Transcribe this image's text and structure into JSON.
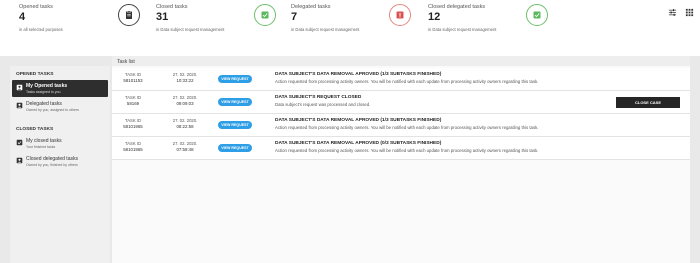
{
  "stats": [
    {
      "label": "Opened tasks",
      "value": "4",
      "sub": "in all selected purposes",
      "icon": "clipboard-icon",
      "tone": "dark"
    },
    {
      "label": "Closed tasks",
      "value": "31",
      "sub": "in Data subject request management",
      "icon": "check-box-icon",
      "tone": "green"
    },
    {
      "label": "Delegated tasks",
      "value": "7",
      "sub": "in Data subject request management",
      "icon": "alert-box-icon",
      "tone": "red"
    },
    {
      "label": "Closed delegated tasks",
      "value": "12",
      "sub": "in Data subject request management",
      "icon": "check-box-icon",
      "tone": "green"
    }
  ],
  "colors": {
    "accent": "#2e9ee6",
    "dark": "#2e2e2e",
    "green": "#5cb85c",
    "red": "#d9534f"
  },
  "sidebar": {
    "opened_title": "OPENED TASKS",
    "closed_title": "CLOSED TASKS",
    "items": [
      {
        "title": "My Opened tasks",
        "desc": "Tasks assigned to you",
        "icon": "user-tasks-icon"
      },
      {
        "title": "Delegated tasks",
        "desc": "Owned by you, assigned to others",
        "icon": "delegated-tasks-icon"
      },
      {
        "title": "My closed tasks",
        "desc": "Your finished tasks",
        "icon": "closed-tasks-icon"
      },
      {
        "title": "Closed delegated tasks",
        "desc": "Owned by you, finished by others",
        "icon": "closed-delegated-icon"
      }
    ]
  },
  "panel": {
    "title": "Task list"
  },
  "tasks": [
    {
      "id_label": "TASK ID",
      "id": "58101153",
      "date": "27. 02. 2020.",
      "time": "10:33:22",
      "button": "VIEW REQUEST",
      "title": "DATA SUBJECT'S DATA REMOVAL APROVED (1/3 SUBTASKS FINISHED)",
      "desc": "Action requested from processing activity owners. You will be notified with each update from processing activity owners regarding this task."
    },
    {
      "id_label": "TASK ID",
      "id": "58169",
      "date": "27. 02. 2020.",
      "time": "09:09:03",
      "button": "VIEW REQUEST",
      "title": "DATA SUBJECT'S REQUEST CLOSED",
      "desc": "Data subject's request was processed and closed.",
      "action": "CLOSE CASE"
    },
    {
      "id_label": "TASK ID",
      "id": "58101965",
      "date": "27. 02. 2020.",
      "time": "08:22:58",
      "button": "VIEW REQUEST",
      "title": "DATA SUBJECT'S DATA REMOVAL APROVED (1/3 SUBTASKS FINISHED)",
      "desc": "Action requested from processing activity owners. You will be notified with each update from processing activity owners regarding this task."
    },
    {
      "id_label": "TASK ID",
      "id": "58101965",
      "date": "27. 02. 2020.",
      "time": "07:58:48",
      "button": "VIEW REQUEST",
      "title": "DATA SUBJECT'S DATA REMOVAL APROVED (0/3 SUBTASKS FINISHED)",
      "desc": "Action requested from processing activity owners. You will be notified with each update from processing activity owners regarding this task."
    }
  ]
}
